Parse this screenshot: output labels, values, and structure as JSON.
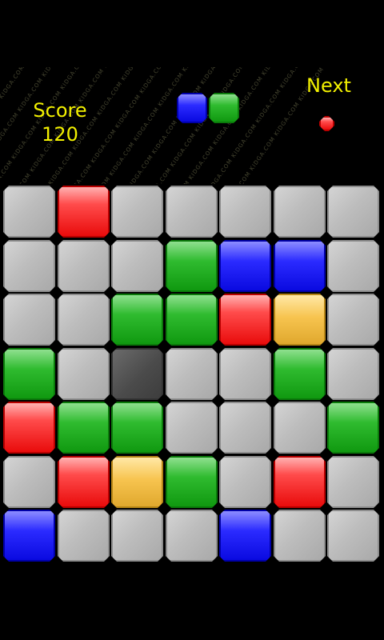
{
  "header": {
    "score_label": "Score",
    "score_value": "120",
    "next_label": "Next",
    "watermark": "KIDGA.COM"
  },
  "current_piece": [
    "blue",
    "green"
  ],
  "next_piece": [
    "red"
  ],
  "board": [
    [
      "gray",
      "red",
      "gray",
      "gray",
      "gray",
      "gray",
      "gray"
    ],
    [
      "gray",
      "gray",
      "gray",
      "green",
      "blue",
      "blue",
      "gray"
    ],
    [
      "gray",
      "gray",
      "green",
      "green",
      "red",
      "yellow",
      "gray"
    ],
    [
      "green",
      "gray",
      "dark",
      "gray",
      "gray",
      "green",
      "gray"
    ],
    [
      "red",
      "green",
      "green",
      "gray",
      "gray",
      "gray",
      "green"
    ],
    [
      "gray",
      "red",
      "yellow",
      "green",
      "gray",
      "red",
      "gray"
    ],
    [
      "blue",
      "gray",
      "gray",
      "gray",
      "blue",
      "gray",
      "gray"
    ]
  ],
  "colors": {
    "background": "#000000",
    "text": "#f2f000",
    "red": "#ff2b2b",
    "green": "#22aa22",
    "blue": "#1a1aff",
    "yellow": "#f2b83a",
    "gray": "#bdbdbd",
    "dark": "#4b4b4b"
  }
}
